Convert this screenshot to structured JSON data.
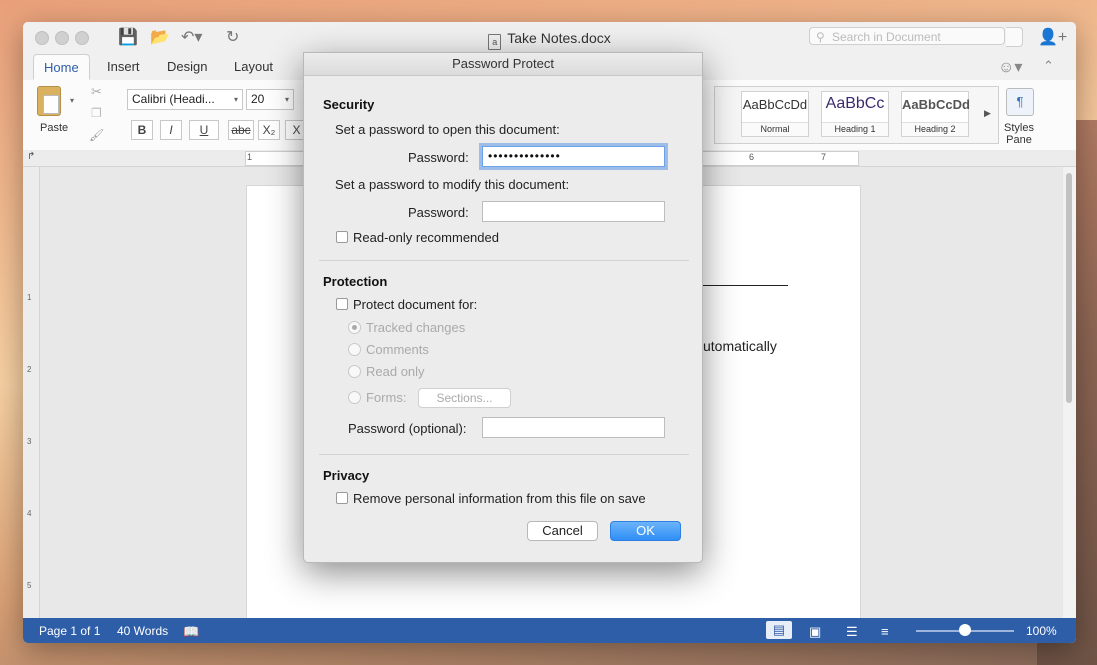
{
  "window": {
    "title": "Take Notes.docx",
    "search_placeholder": "Search in Document"
  },
  "tabs": [
    "Home",
    "Insert",
    "Design",
    "Layout"
  ],
  "ribbon": {
    "paste_label": "Paste",
    "font_name": "Calibri (Headi...",
    "font_size": "20",
    "format_buttons": [
      "B",
      "I",
      "U",
      "abc",
      "X₂",
      "X"
    ],
    "styles": [
      {
        "sample": "AaBbCcDd",
        "name": "Normal"
      },
      {
        "sample": "AaBbCc",
        "name": "Heading 1"
      },
      {
        "sample": "AaBbCcDd",
        "name": "Heading 2"
      }
    ],
    "styles_pane_label": "Styles Pane"
  },
  "ruler": {
    "marks": [
      "1",
      "6",
      "7"
    ]
  },
  "vertical_ruler": [
    "1",
    "2",
    "3",
    "4",
    "5"
  ],
  "document": {
    "visible_text": "utomatically"
  },
  "status_bar": {
    "page": "Page 1 of 1",
    "words": "40 Words",
    "zoom": "100%",
    "zoom_fraction": 0.5
  },
  "dialog": {
    "title": "Password Protect",
    "security": {
      "heading": "Security",
      "open_label": "Set a password to open this document:",
      "open_password_label": "Password:",
      "open_password_value": "••••••••••••••",
      "modify_label": "Set a password to modify this document:",
      "modify_password_label": "Password:",
      "modify_password_value": "",
      "readonly_label": "Read-only recommended"
    },
    "protection": {
      "heading": "Protection",
      "protect_label": "Protect document for:",
      "options": [
        "Tracked changes",
        "Comments",
        "Read only",
        "Forms:"
      ],
      "sections_button": "Sections...",
      "optional_password_label": "Password (optional):",
      "optional_password_value": ""
    },
    "privacy": {
      "heading": "Privacy",
      "remove_info_label": "Remove personal information from this file on save"
    },
    "cancel_label": "Cancel",
    "ok_label": "OK"
  }
}
